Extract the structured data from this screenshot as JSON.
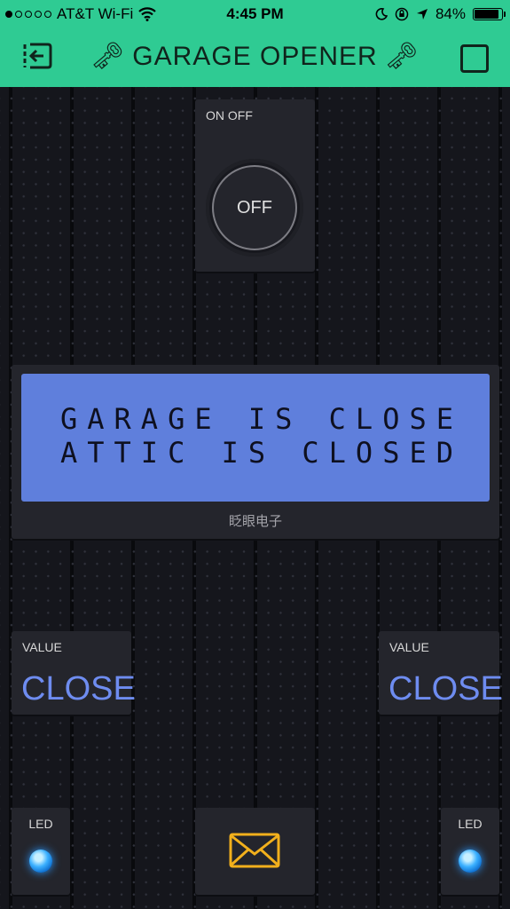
{
  "status_bar": {
    "carrier": "AT&T Wi-Fi",
    "time": "4:45 PM",
    "battery": "84%",
    "battery_level": 0.84
  },
  "app_bar": {
    "title": "GARAGE OPENER"
  },
  "button_widget": {
    "label": "ON OFF",
    "state": "OFF"
  },
  "lcd_widget": {
    "line1": "GARAGE IS CLOSE",
    "line2": "ATTIC IS CLOSED",
    "caption": "眨眼电子"
  },
  "value_left": {
    "label": "VALUE",
    "value": "CLOSE"
  },
  "value_right": {
    "label": "VALUE",
    "value": "CLOSE"
  },
  "led_left": {
    "label": "LED"
  },
  "led_right": {
    "label": "LED"
  },
  "colors": {
    "accent": "#2fcb93",
    "background": "#15161c",
    "widget": "#24252c",
    "lcd": "#5f7fdc",
    "value_text": "#6e8cf0",
    "envelope": "#f2b01c",
    "led": "#2b98ff"
  }
}
